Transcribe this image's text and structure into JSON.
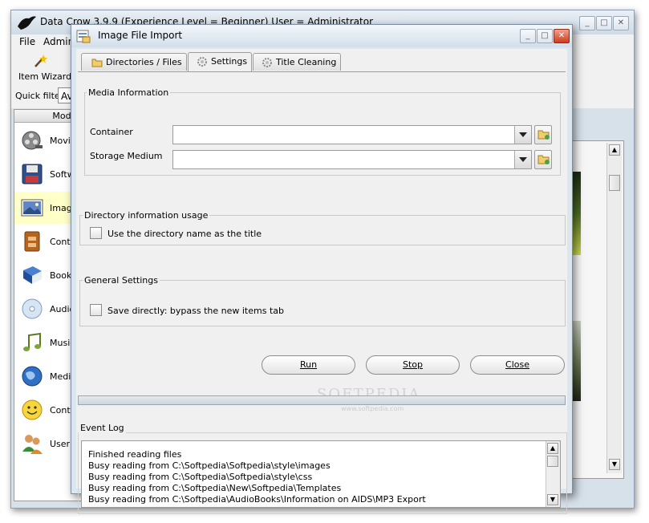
{
  "main_window": {
    "title": "Data Crow 3.9.9   (Experience Level = Beginner)   User = Administrator",
    "menu": [
      "File",
      "Admini"
    ],
    "toolbar": {
      "item_wizard_label": "Item Wizard"
    },
    "quick_filter": {
      "label": "Quick filter",
      "value": "Av"
    },
    "module_panel": {
      "header": "Modu",
      "items": [
        {
          "label": "Movie",
          "icon": "film-reel-icon"
        },
        {
          "label": "Softw",
          "icon": "floppy-disk-icon"
        },
        {
          "label": "Image",
          "icon": "picture-icon",
          "selected": true
        },
        {
          "label": "Conta",
          "icon": "cabinet-icon"
        },
        {
          "label": "Book",
          "icon": "book-icon"
        },
        {
          "label": "Audio",
          "icon": "cd-icon"
        },
        {
          "label": "Music",
          "icon": "music-note-icon"
        },
        {
          "label": "Media",
          "icon": "globe-icon"
        },
        {
          "label": "Conta",
          "icon": "smiley-icon"
        },
        {
          "label": "User",
          "icon": "users-icon"
        }
      ]
    }
  },
  "dialog": {
    "title": "Image File Import",
    "tabs": [
      {
        "label": "Directories / Files",
        "icon": "folder-icon"
      },
      {
        "label": "Settings",
        "icon": "gear-icon",
        "active": true
      },
      {
        "label": "Title Cleaning",
        "icon": "gear-icon"
      }
    ],
    "media_information": {
      "title": "Media Information",
      "container_label": "Container",
      "container_value": "",
      "storage_medium_label": "Storage Medium",
      "storage_medium_value": ""
    },
    "directory_usage": {
      "title": "Directory information usage",
      "checkbox_label": "Use the directory name as the title",
      "checked": false
    },
    "general_settings": {
      "title": "General Settings",
      "checkbox_label": "Save directly: bypass the new items tab",
      "checked": false
    },
    "buttons": {
      "run": "Run",
      "stop": "Stop",
      "close": "Close"
    },
    "progress": 0,
    "event_log": {
      "title": "Event Log",
      "lines": [
        "Finished reading files",
        "Busy reading from C:\\Softpedia\\Softpedia\\style\\images",
        "Busy reading from C:\\Softpedia\\Softpedia\\style\\css",
        "Busy reading from C:\\Softpedia\\New\\Softpedia\\Templates",
        "Busy reading from C:\\Softpedia\\AudioBooks\\Information on AIDS\\MP3 Export"
      ]
    },
    "watermark": "SOFTPEDIA",
    "watermark_url": "www.softpedia.com"
  }
}
